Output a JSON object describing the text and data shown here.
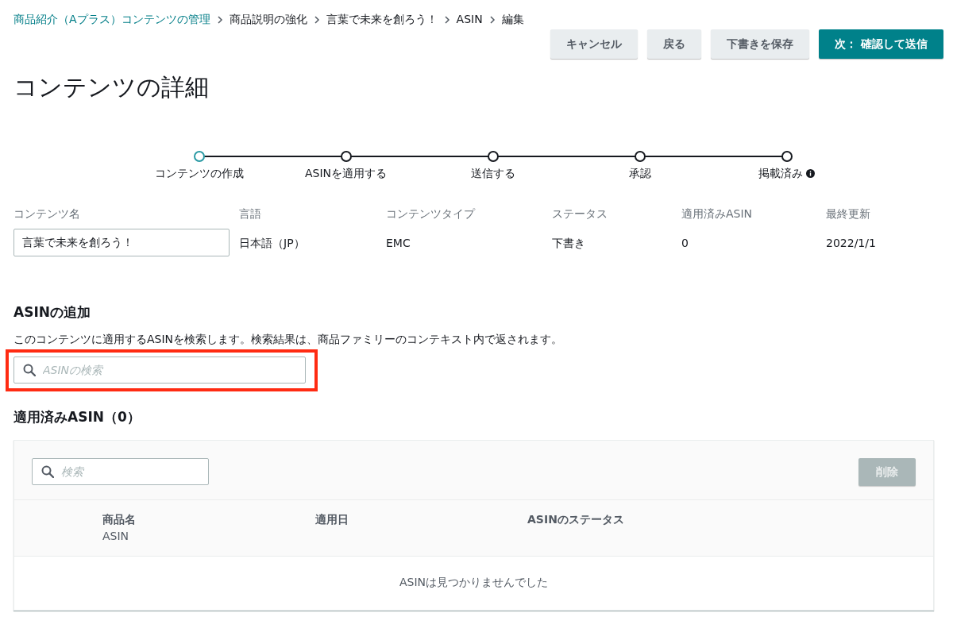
{
  "breadcrumb": [
    {
      "label": "商品紹介（Aプラス）コンテンツの管理",
      "link": true
    },
    {
      "label": "商品説明の強化",
      "link": false
    },
    {
      "label": "言葉で未来を創ろう！",
      "link": false
    },
    {
      "label": "ASIN",
      "link": false
    },
    {
      "label": "編集",
      "link": false
    }
  ],
  "actions": [
    {
      "label": "キャンセル",
      "kind": "secondary"
    },
    {
      "label": "戻る",
      "kind": "secondary"
    },
    {
      "label": "下書きを保存",
      "kind": "secondary"
    },
    {
      "label": "次： 確認して送信",
      "kind": "primary"
    }
  ],
  "page_title": "コンテンツの詳細",
  "steps": [
    {
      "label": "コンテンツの作成",
      "selected": true,
      "info": false
    },
    {
      "label": "ASINを適用する",
      "selected": false,
      "info": false
    },
    {
      "label": "送信する",
      "selected": false,
      "info": false
    },
    {
      "label": "承認",
      "selected": false,
      "info": false
    },
    {
      "label": "掲載済み",
      "selected": false,
      "info": true
    }
  ],
  "details": [
    {
      "label": "コンテンツ名",
      "value": "言葉で未来を創ろう！",
      "kind": "input"
    },
    {
      "label": "言語",
      "value": "日本語（JP）",
      "kind": "text"
    },
    {
      "label": "コンテンツタイプ",
      "value": "EMC",
      "kind": "text"
    },
    {
      "label": "ステータス",
      "value": "下書き",
      "kind": "text"
    },
    {
      "label": "適用済みASIN",
      "value": "0",
      "kind": "text"
    },
    {
      "label": "最終更新",
      "value": "2022/1/1",
      "kind": "text"
    }
  ],
  "add_asin": {
    "heading": "ASINの追加",
    "description": "このコンテンツに適用するASINを検索します。検索結果は、商品ファミリーのコンテキスト内で返されます。",
    "search": {
      "placeholder": "ASINの検索",
      "highlighted": true
    }
  },
  "applied": {
    "heading": "適用済みASIN（0）",
    "search": {
      "placeholder": "検索"
    },
    "delete_button": {
      "label": "削除",
      "disabled": true
    },
    "columns": [
      {
        "label": "商品名",
        "sublabel": "ASIN"
      },
      {
        "label": "適用日"
      },
      {
        "label": "ASINのステータス"
      }
    ],
    "empty_message": "ASINは見つかりませんでした"
  }
}
